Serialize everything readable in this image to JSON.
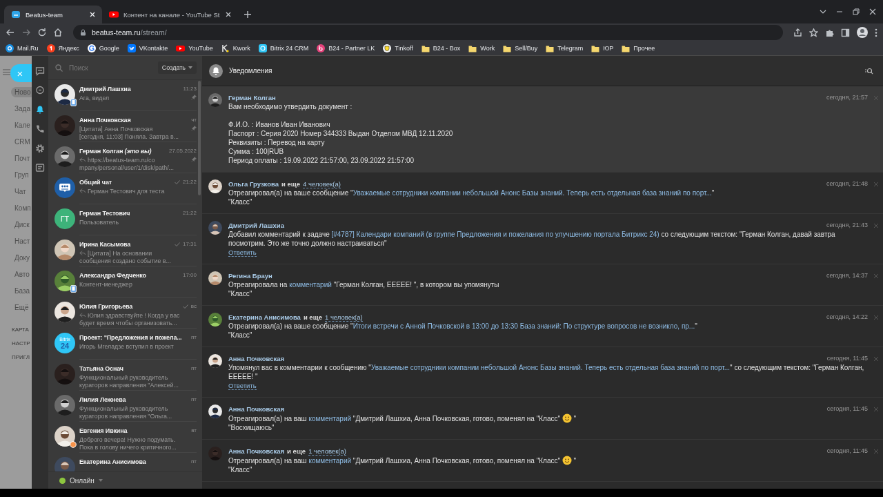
{
  "browser": {
    "tabs": [
      {
        "title": "Beatus-team",
        "kind": "site",
        "selected": true
      },
      {
        "title": "Контент на канале - YouTube St",
        "kind": "youtube",
        "selected": false
      }
    ],
    "url": {
      "host": "beatus-team.ru",
      "path": "/stream/"
    },
    "bookmarks": [
      {
        "label": "Mail.Ru",
        "kind": "mail"
      },
      {
        "label": "Яндекс",
        "kind": "yandex"
      },
      {
        "label": "Google",
        "kind": "google"
      },
      {
        "label": "VKontakte",
        "kind": "vk"
      },
      {
        "label": "YouTube",
        "kind": "youtube"
      },
      {
        "label": "Kwork",
        "kind": "kwork"
      },
      {
        "label": "Bitrix 24 CRM",
        "kind": "bitrix"
      },
      {
        "label": "B24 - Partner LK",
        "kind": "partner"
      },
      {
        "label": "Tinkoff",
        "kind": "tinkoff"
      },
      {
        "label": "B24 - Box",
        "kind": "folder"
      },
      {
        "label": "Work",
        "kind": "folder"
      },
      {
        "label": "Sell/Buy",
        "kind": "folder"
      },
      {
        "label": "Telegram",
        "kind": "folder"
      },
      {
        "label": "ЮР",
        "kind": "folder"
      },
      {
        "label": "Прочее",
        "kind": "folder"
      }
    ]
  },
  "portal": {
    "close": "×",
    "menu": [
      {
        "label": "Ново",
        "selected": true
      },
      {
        "label": "Зада",
        "selected": false
      },
      {
        "label": "Кале",
        "selected": false
      },
      {
        "label": "CRM",
        "selected": false
      },
      {
        "label": "Почт",
        "selected": false
      },
      {
        "label": "Груп",
        "selected": false
      },
      {
        "label": "Чат",
        "selected": false
      },
      {
        "label": "Комп",
        "selected": false
      },
      {
        "label": "Диск",
        "selected": false
      },
      {
        "label": "Наст",
        "selected": false
      },
      {
        "label": "Доку",
        "selected": false
      },
      {
        "label": "Авто",
        "selected": false
      },
      {
        "label": "База",
        "selected": false
      },
      {
        "label": "Ещё",
        "selected": false
      }
    ],
    "sections": [
      "КАРТА",
      "НАСТР",
      "ПРИГЛ"
    ]
  },
  "nav": [
    {
      "kind": "chat",
      "selected": false
    },
    {
      "kind": "openlines",
      "selected": false
    },
    {
      "kind": "notifications",
      "selected": true
    },
    {
      "kind": "calls",
      "selected": false
    },
    {
      "kind": "settings",
      "selected": false
    },
    {
      "kind": "tasks",
      "selected": false
    }
  ],
  "chat_list": {
    "search_placeholder": "Поиск",
    "create": "Создать",
    "chats": [
      {
        "name": "Дмитрий Лашхиа",
        "time": "11:23",
        "avatar": {
          "kind": "picture"
        },
        "badge": {
          "kind": "mobile"
        },
        "pinned": true,
        "read": false,
        "reply": false,
        "preview": [
          "Ага, видел"
        ]
      },
      {
        "name": "Анна Почковская",
        "time": "чт",
        "avatar": {
          "kind": "picture"
        },
        "pinned": true,
        "read": false,
        "reply": false,
        "preview": [
          "[Цитата] Анна Почковская",
          "[сегодня, 11:03] Поняла. Завтра в..."
        ]
      },
      {
        "name": "Герман Колган *(это вы)*",
        "time": "27.05.2022",
        "avatar": {
          "kind": "picture"
        },
        "pinned": true,
        "read": false,
        "reply": true,
        "preview": [
          "https://beatus-team.ru/co",
          "mpany/personal/user/1/disk/path/..."
        ]
      },
      {
        "name": "Общий чат",
        "time": "21:22",
        "avatar": {
          "kind": "group"
        },
        "pinned": false,
        "read": true,
        "reply": true,
        "preview": [
          "Герман Тестович для теста"
        ]
      },
      {
        "name": "Герман Тестович",
        "time": "21:22",
        "avatar": {
          "kind": "initials",
          "text": "ГТ"
        },
        "pinned": false,
        "read": false,
        "reply": false,
        "preview": [
          "Пользователь"
        ]
      },
      {
        "name": "Ирина Касымова",
        "time": "17:31",
        "avatar": {
          "kind": "picture"
        },
        "pinned": false,
        "read": true,
        "reply": true,
        "preview": [
          "[Цитата] На основании",
          "сообщения создано событие в..."
        ]
      },
      {
        "name": "Александра Федченко",
        "time": "17:00",
        "avatar": {
          "kind": "picture"
        },
        "badge": {
          "kind": "mobile"
        },
        "pinned": false,
        "read": false,
        "reply": false,
        "preview": [
          "Контент-менеджер"
        ]
      },
      {
        "name": "Юлия Григорьева",
        "time": "вс",
        "avatar": {
          "kind": "picture"
        },
        "pinned": false,
        "read": true,
        "reply": true,
        "preview": [
          "Юлия здравствуйте ! Когда у вас",
          "будет время чтобы организовать..."
        ]
      },
      {
        "name": "Проект: \"Предложения и пожела...",
        "time": "пт",
        "avatar": {
          "kind": "logo",
          "text": [
            "Bitrix",
            "24"
          ]
        },
        "pinned": false,
        "read": false,
        "reply": false,
        "preview": [
          "Игорь Мгеладзе вступил в проект"
        ]
      },
      {
        "name": "Татьяна Оснач",
        "time": "пт",
        "avatar": {
          "kind": "picture"
        },
        "pinned": false,
        "read": false,
        "reply": false,
        "preview": [
          "Функциональный руководитель",
          "кураторов направления \"Алексей..."
        ]
      },
      {
        "name": "Лилия Лежнева",
        "time": "пт",
        "avatar": {
          "kind": "picture"
        },
        "pinned": false,
        "read": false,
        "reply": false,
        "preview": [
          "Функциональный руководитель",
          "кураторов направления \"Ольга..."
        ]
      },
      {
        "name": "Евгения Ивкина",
        "time": "вт",
        "avatar": {
          "kind": "picture"
        },
        "badge": {
          "kind": "away"
        },
        "pinned": false,
        "read": false,
        "reply": false,
        "preview": [
          "Доброго вечера! Нужно подумать.",
          "Пока в голову ничего критичного..."
        ]
      },
      {
        "name": "Екатерина Анисимова",
        "time": "пт",
        "avatar": {
          "kind": "picture"
        },
        "pinned": false,
        "read": false,
        "reply": false
      }
    ]
  },
  "status": {
    "label": "Онлайн",
    "color": "#8dc63f"
  },
  "notifications": {
    "title": "Уведомления",
    "items": [
      {
        "name": "Герман Колган",
        "time": "сегодня, 21:57",
        "unread": true,
        "body": [
          {
            "kind": "text",
            "text": "Вам необходимо утвердить документ :"
          }
        ],
        "details": [
          "Ф.И.О. : Иванов Иван Иванович",
          "Паспорт : Серия 2020 Номер 344333 Выдан Отделом МВД 12.11.2020",
          "Реквизиты : Перевод на карту",
          "Сумма : 100|RUB",
          "Период оплаты : 19.09.2022 21:57:00, 23.09.2022 21:57:00"
        ]
      },
      {
        "name": "Ольга Грузкова",
        "more": {
          "text": "и еще",
          "link": "4 человек(а)"
        },
        "time": "сегодня, 21:48",
        "unread": false,
        "body": [
          {
            "kind": "text",
            "text": "Отреагировал(а) на ваше сообщение \""
          },
          {
            "kind": "link",
            "text": "Уважаемые сотрудники компании небольшой Анонс Базы знаний. Теперь есть отдельная база знаний по порт..."
          },
          {
            "kind": "text",
            "text": "\""
          }
        ],
        "quote": "\"Класс\""
      },
      {
        "name": "Дмитрий Лашхиа",
        "time": "сегодня, 21:43",
        "unread": false,
        "body": [
          {
            "kind": "text",
            "text": "Добавил комментарий к задаче "
          },
          {
            "kind": "link",
            "text": "[#4787] Календари компаний (в группе Предложения и пожелания по улучшению портала Битрикс 24)"
          },
          {
            "kind": "text",
            "text": " со следующим текстом: \"Герман Колган, давай завтра посмотрим. Это же точно должно настраиваться\""
          }
        ],
        "reply": "Ответить"
      },
      {
        "name": "Регина Браун",
        "time": "сегодня, 14:37",
        "unread": false,
        "body": [
          {
            "kind": "text",
            "text": "Отреагировала на "
          },
          {
            "kind": "link",
            "text": "комментарий"
          },
          {
            "kind": "text",
            "text": " \"Герман Колган, ЕЕЕЕЕ! \", в котором вы упомянуты"
          }
        ],
        "quote": "\"Класс\""
      },
      {
        "name": "Екатерина Анисимова",
        "more": {
          "text": "и еще",
          "link": "1 человек(а)"
        },
        "time": "сегодня, 14:22",
        "unread": false,
        "body": [
          {
            "kind": "text",
            "text": "Отреагировал(а) на ваше сообщение \""
          },
          {
            "kind": "link",
            "text": "Итоги встречи с Анной Почковской в 13:00 до 13:30 База знаний: По структуре вопросов не возникло, пр..."
          },
          {
            "kind": "text",
            "text": "\""
          }
        ],
        "quote": "\"Класс\""
      },
      {
        "name": "Анна Почковская",
        "time": "сегодня, 11:45",
        "unread": false,
        "body": [
          {
            "kind": "text",
            "text": "Упомянул вас в комментарии к сообщению \""
          },
          {
            "kind": "link",
            "text": "Уважаемые сотрудники компании небольшой Анонс Базы знаний. Теперь есть отдельная база знаний по порт..."
          },
          {
            "kind": "text",
            "text": "\" со следующим текстом: \"Герман Колган, ЕЕЕЕЕ! \""
          }
        ],
        "reply": "Ответить"
      },
      {
        "name": "Анна Почковская",
        "time": "сегодня, 11:45",
        "unread": false,
        "body": [
          {
            "kind": "text",
            "text": "Отреагировал(а) на ваш "
          },
          {
            "kind": "link",
            "text": "комментарий"
          },
          {
            "kind": "text",
            "text": " \"Дмитрий Лашхиа, Анна Почковская, готово, поменял на \"Класс\" "
          },
          {
            "kind": "smiley"
          },
          {
            "kind": "text",
            "text": " \""
          }
        ],
        "quote": "\"Восхищаюсь\""
      },
      {
        "name": "Анна Почковская",
        "more": {
          "text": "и еще",
          "link": "1 человек(а)"
        },
        "time": "сегодня, 11:45",
        "unread": false,
        "body": [
          {
            "kind": "text",
            "text": "Отреагировал(а) на ваш "
          },
          {
            "kind": "link",
            "text": "комментарий"
          },
          {
            "kind": "text",
            "text": " \"Дмитрий Лашхиа, Анна Почковская, готово, поменял на \"Класс\" "
          },
          {
            "kind": "smiley"
          },
          {
            "kind": "text",
            "text": " \""
          }
        ],
        "quote": "\"Класс\""
      }
    ]
  }
}
